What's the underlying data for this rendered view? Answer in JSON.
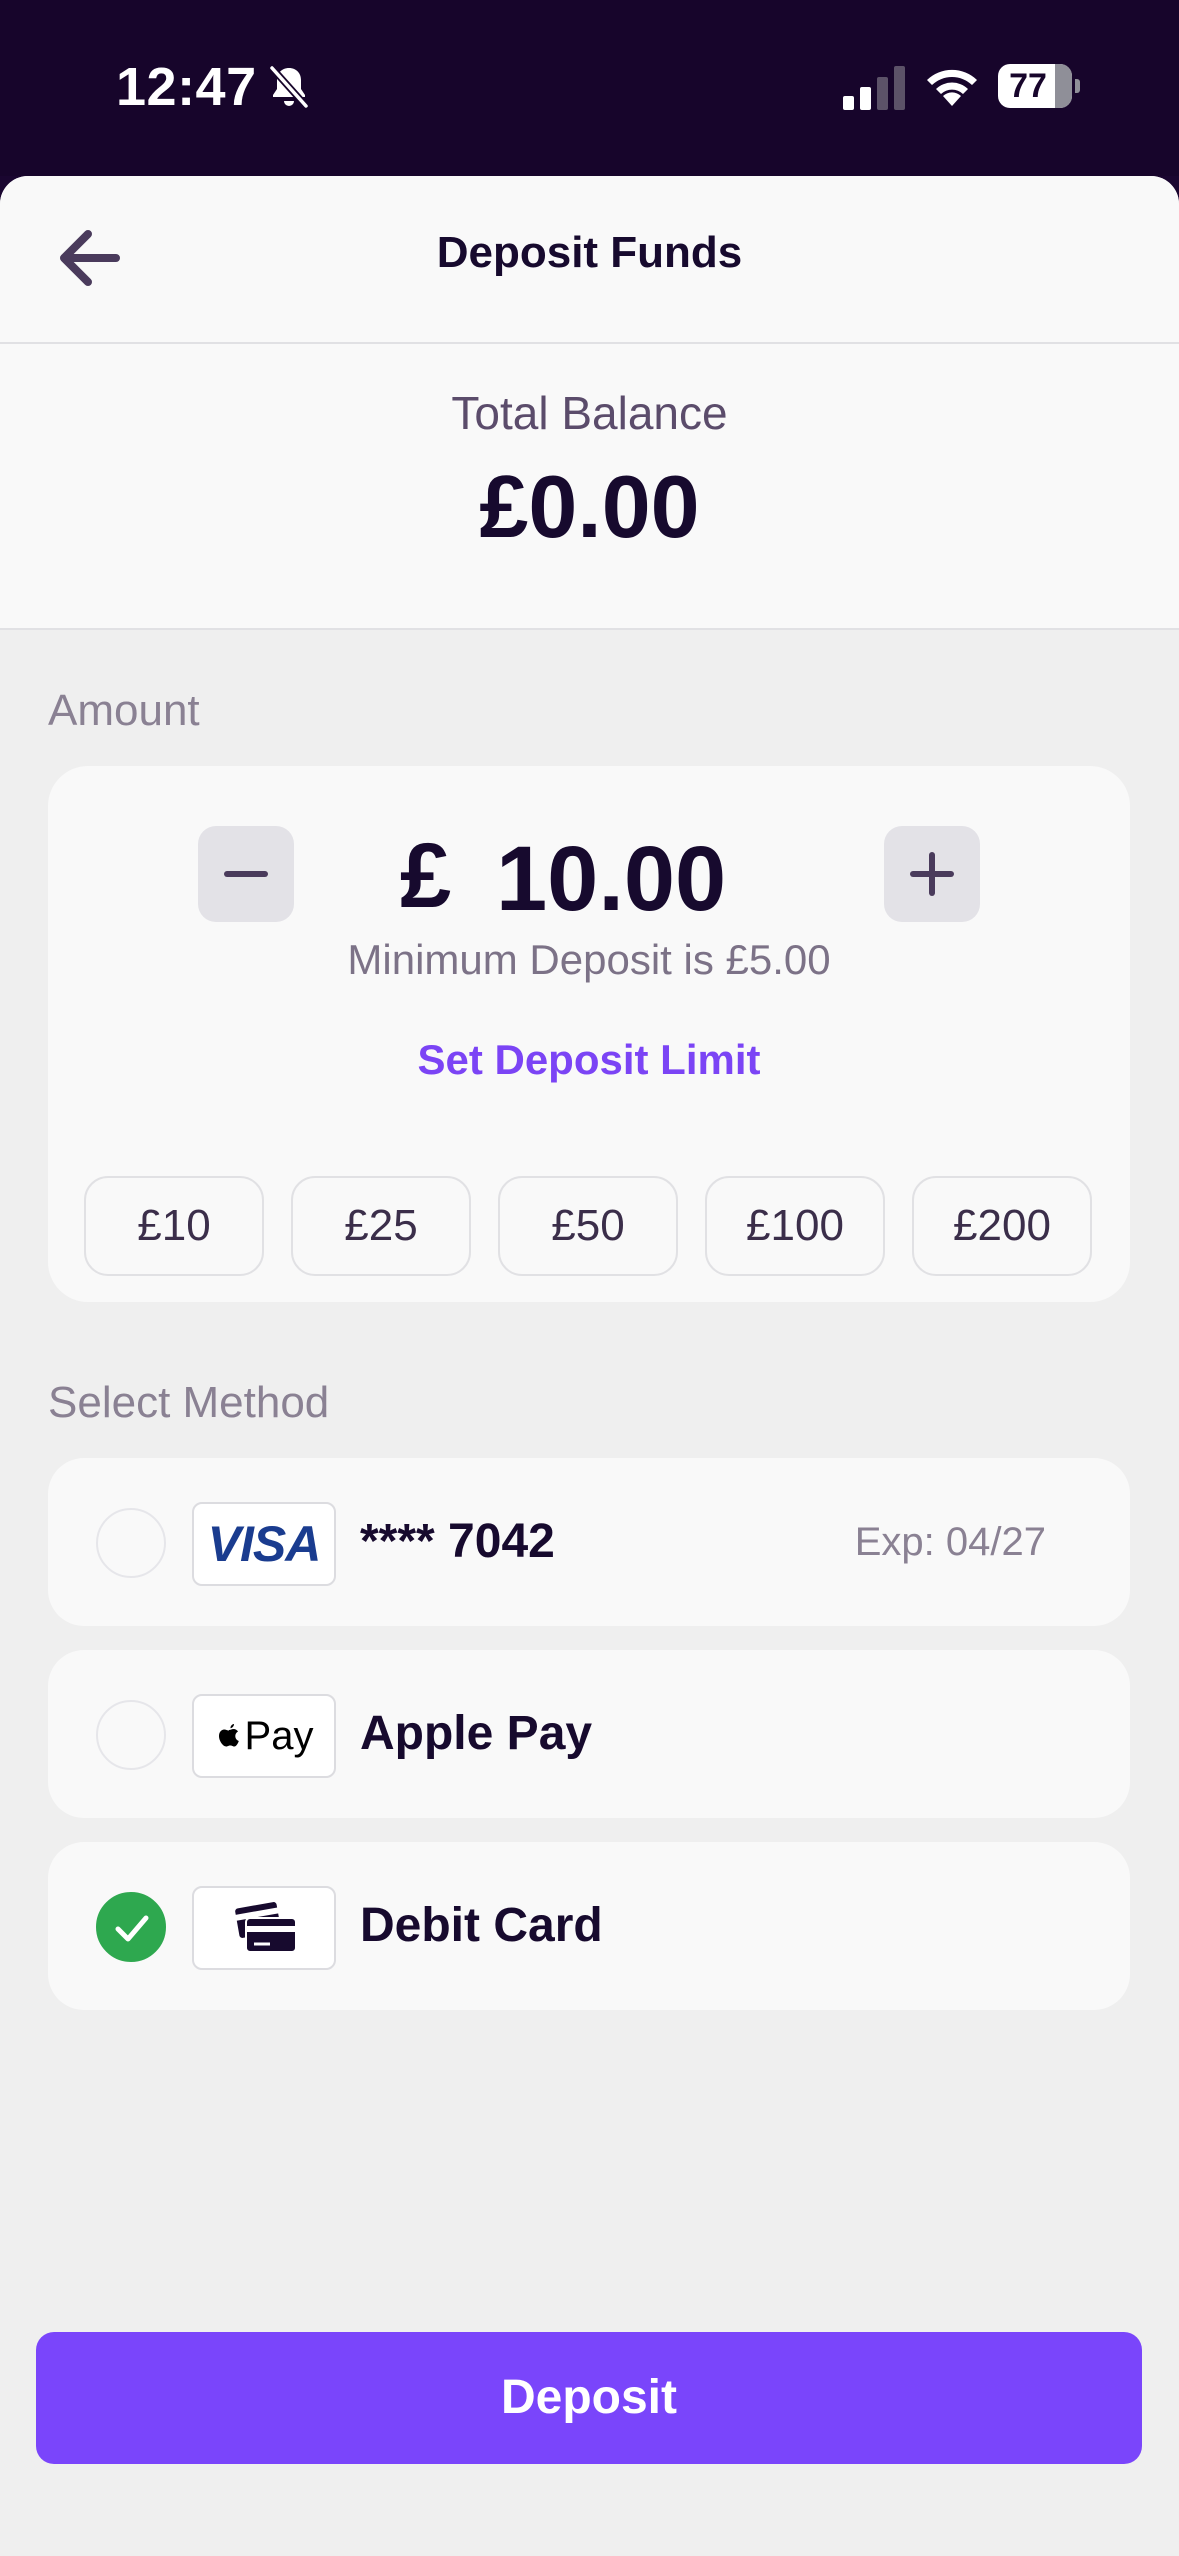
{
  "status_bar": {
    "time": "12:47",
    "battery": "77",
    "battery_level": 0.77,
    "icons": [
      "bell-slash-icon",
      "cellular-signal-icon",
      "wifi-icon",
      "battery-icon"
    ]
  },
  "header": {
    "title": "Deposit Funds",
    "back_icon": "arrow-left-icon"
  },
  "balance": {
    "label": "Total Balance",
    "value": "£0.00"
  },
  "amount": {
    "section_label": "Amount",
    "currency": "£",
    "value": "10.00",
    "minimum_text": "Minimum Deposit is £5.00",
    "limit_link": "Set Deposit Limit",
    "presets": [
      "£10",
      "£25",
      "£50",
      "£100",
      "£200"
    ],
    "decrement_icon": "minus-icon",
    "increment_icon": "plus-icon"
  },
  "methods": {
    "section_label": "Select Method",
    "items": [
      {
        "logo": "VISA",
        "name": "**** 7042",
        "expiry": "Exp: 04/27",
        "selected": false
      },
      {
        "logo": "Pay",
        "name": "Apple Pay",
        "selected": false
      },
      {
        "logo": "card-icon",
        "name": "Debit Card",
        "selected": true
      }
    ]
  },
  "deposit_button": "Deposit",
  "colors": {
    "accent": "#7a45fb",
    "selected": "#2ea84f",
    "status_bar_bg": "#17052b",
    "page_bg": "#efefef"
  }
}
